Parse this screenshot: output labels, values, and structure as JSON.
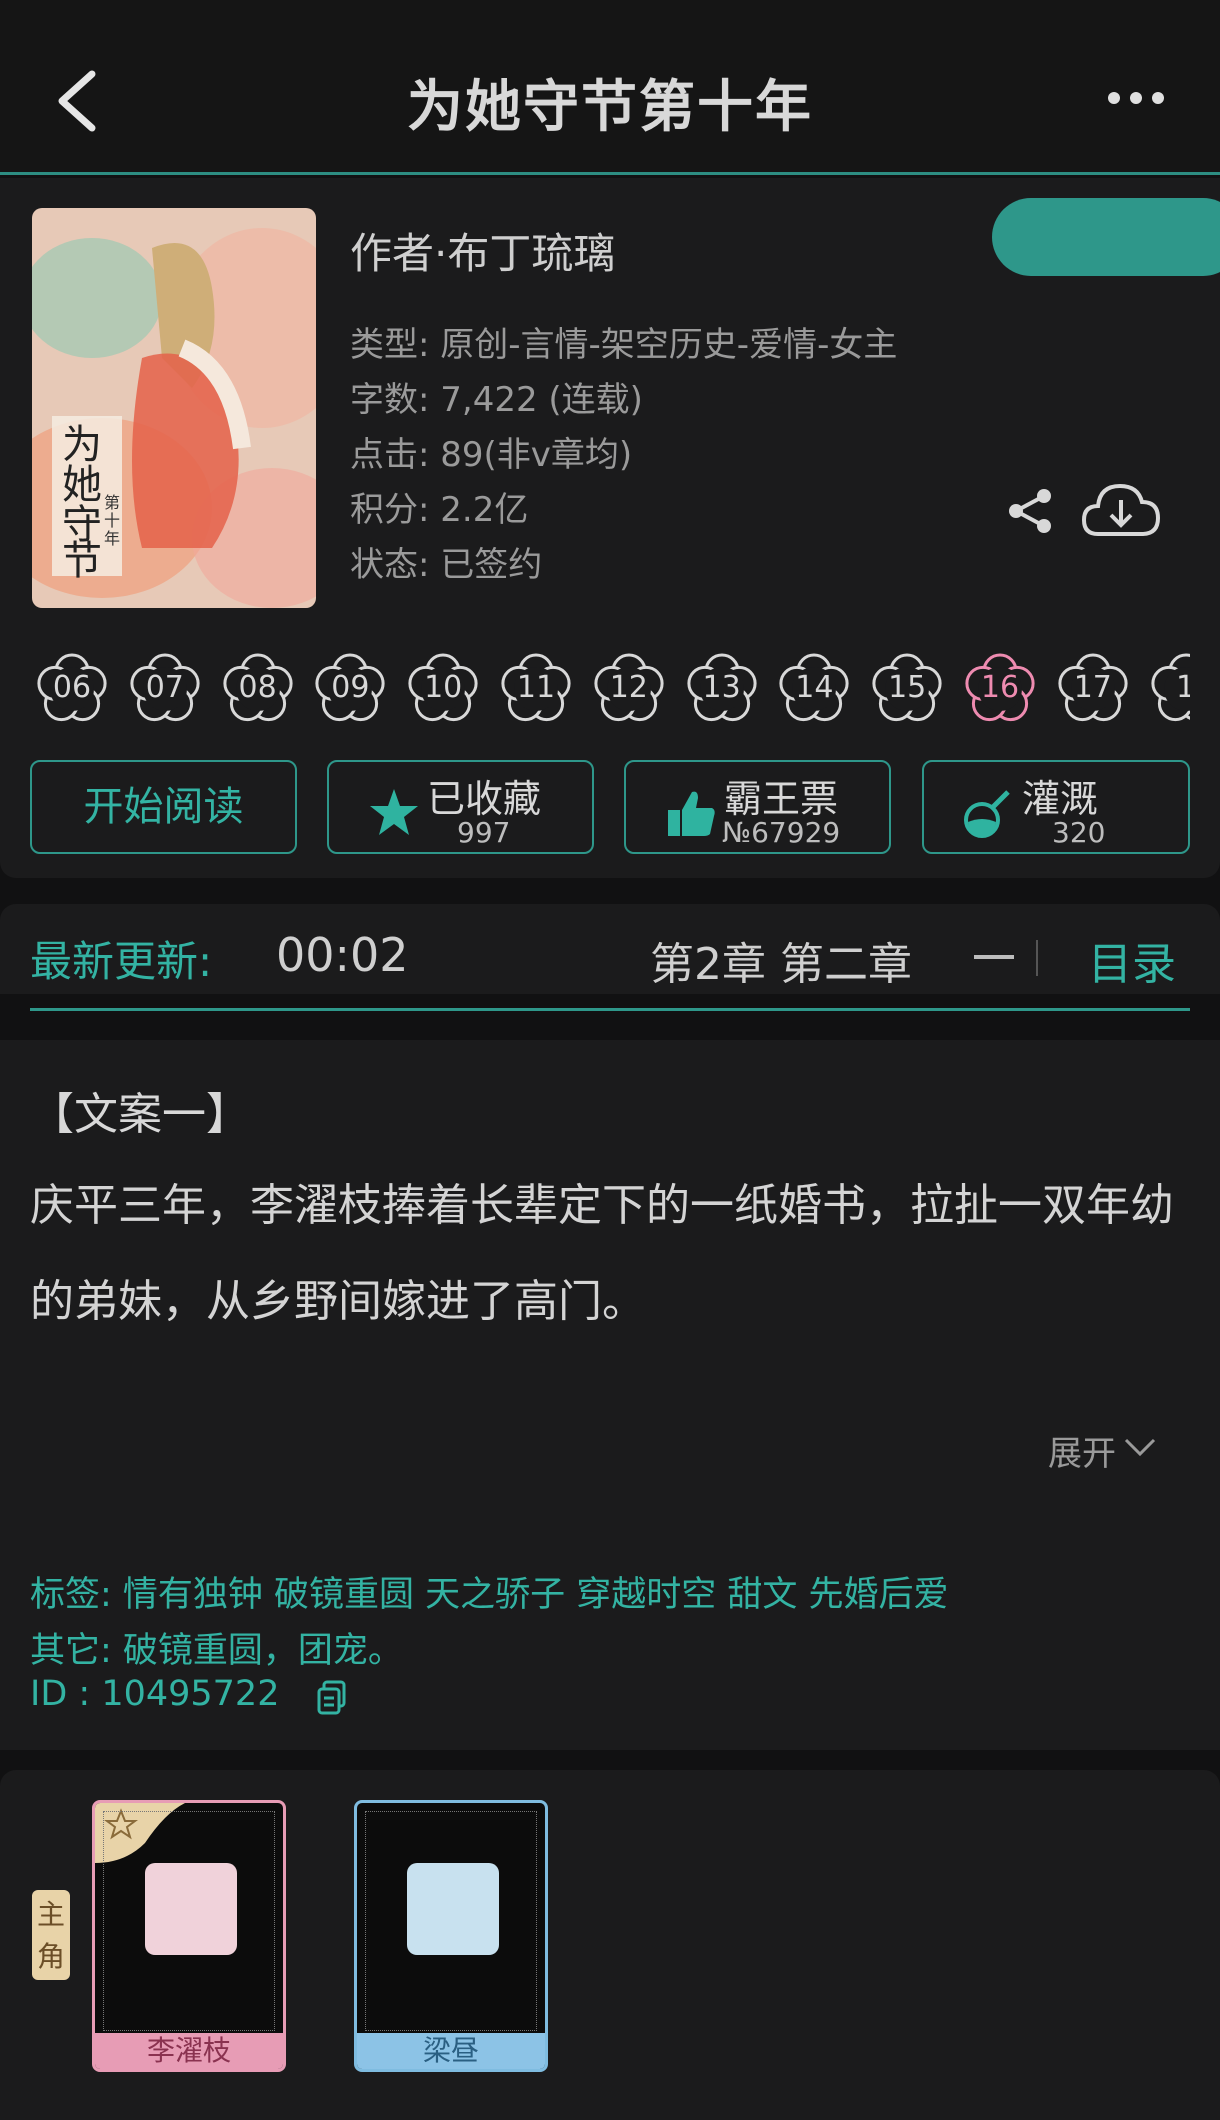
{
  "header": {
    "title": "为她守节第十年"
  },
  "book": {
    "author": "作者·布丁琉璃",
    "type": "类型: 原创-言情-架空历史-爱情-女主",
    "words": "字数: 7,422 (连载)",
    "clicks": "点击: 89(非v章均)",
    "points": "积分: 2.2亿",
    "status": "状态: 已签约",
    "cover_text": "为她守节",
    "cover_sub": "第十年"
  },
  "flowers": [
    "06",
    "07",
    "08",
    "09",
    "10",
    "11",
    "12",
    "13",
    "14",
    "15",
    "16",
    "17",
    "1"
  ],
  "flowers_active_index": 10,
  "buttons": {
    "read": "开始阅读",
    "fav_label": "已收藏",
    "fav_count": "997",
    "vote_label": "霸王票",
    "vote_count": "№67929",
    "water_label": "灌溉",
    "water_count": "320"
  },
  "update": {
    "label": "最新更新:",
    "time": "00:02",
    "chapter": "第2章  第二章",
    "toc": "目录"
  },
  "synopsis": {
    "title": "【文案一】",
    "line1": "庆平三年，李濯枝捧着长辈定下的一纸婚书，拉扯一双年幼",
    "line2": "的弟妹，从乡野间嫁进了高门。",
    "expand": "展开"
  },
  "info": {
    "tags": "标签:  情有独钟 破镜重圆 天之骄子 穿越时空 甜文 先婚后爱",
    "other": "其它:  破镜重圆，团宠。",
    "id": "ID     :  10495722"
  },
  "characters": {
    "badge": "主角",
    "items": [
      "李濯枝",
      "梁昼"
    ]
  },
  "colors": {
    "accent": "#2e978a",
    "accent_text": "#33b3a3",
    "active_flower": "#ee8bb0"
  }
}
